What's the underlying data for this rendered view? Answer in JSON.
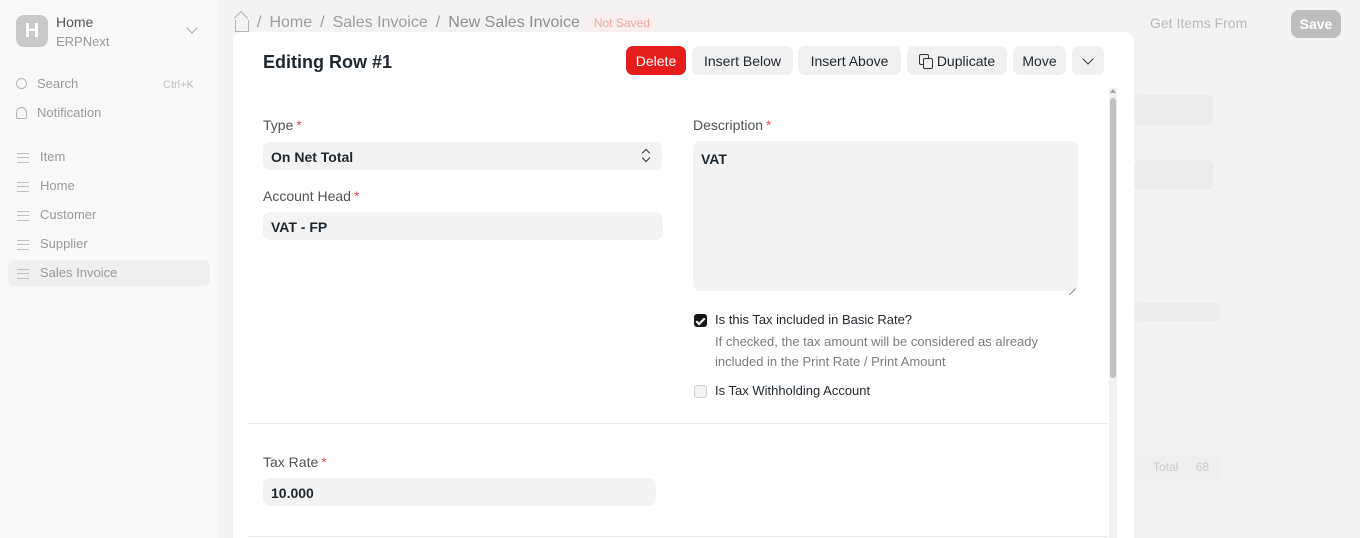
{
  "sidebar": {
    "logo_letter": "H",
    "app_title": "Home",
    "app_subtitle": "ERPNext",
    "search_label": "Search",
    "search_shortcut": "Ctrl+K",
    "notification_label": "Notification",
    "items": [
      {
        "label": "Item"
      },
      {
        "label": "Home"
      },
      {
        "label": "Customer"
      },
      {
        "label": "Supplier"
      },
      {
        "label": "Sales Invoice"
      }
    ]
  },
  "header": {
    "breadcrumbs": [
      "Home",
      "Sales Invoice",
      "New Sales Invoice"
    ],
    "separator": "/",
    "status_badge": "Not Saved",
    "get_items_label": "Get Items From",
    "save_label": "Save"
  },
  "background": {
    "total_label": "Total",
    "total_value": "68"
  },
  "dialog": {
    "title": "Editing Row #1",
    "actions": {
      "delete": "Delete",
      "insert_below": "Insert Below",
      "insert_above": "Insert Above",
      "duplicate": "Duplicate",
      "move": "Move"
    },
    "fields": {
      "type": {
        "label": "Type",
        "required_mark": "*",
        "value": "On Net Total"
      },
      "account_head": {
        "label": "Account Head",
        "required_mark": "*",
        "value": "VAT - FP"
      },
      "description": {
        "label": "Description",
        "required_mark": "*",
        "value": "VAT"
      },
      "included_in_basic_rate": {
        "label": "Is this Tax included in Basic Rate?",
        "checked": true,
        "help_text": "If checked, the tax amount will be considered as already included in the Print Rate / Print Amount"
      },
      "withholding_account": {
        "label": "Is Tax Withholding Account",
        "checked": false
      },
      "tax_rate": {
        "label": "Tax Rate",
        "required_mark": "*",
        "value": "10.000"
      }
    }
  },
  "colors": {
    "danger": "#e51d1d",
    "required": "#e24c4c",
    "checkbox_on": "#171717"
  }
}
